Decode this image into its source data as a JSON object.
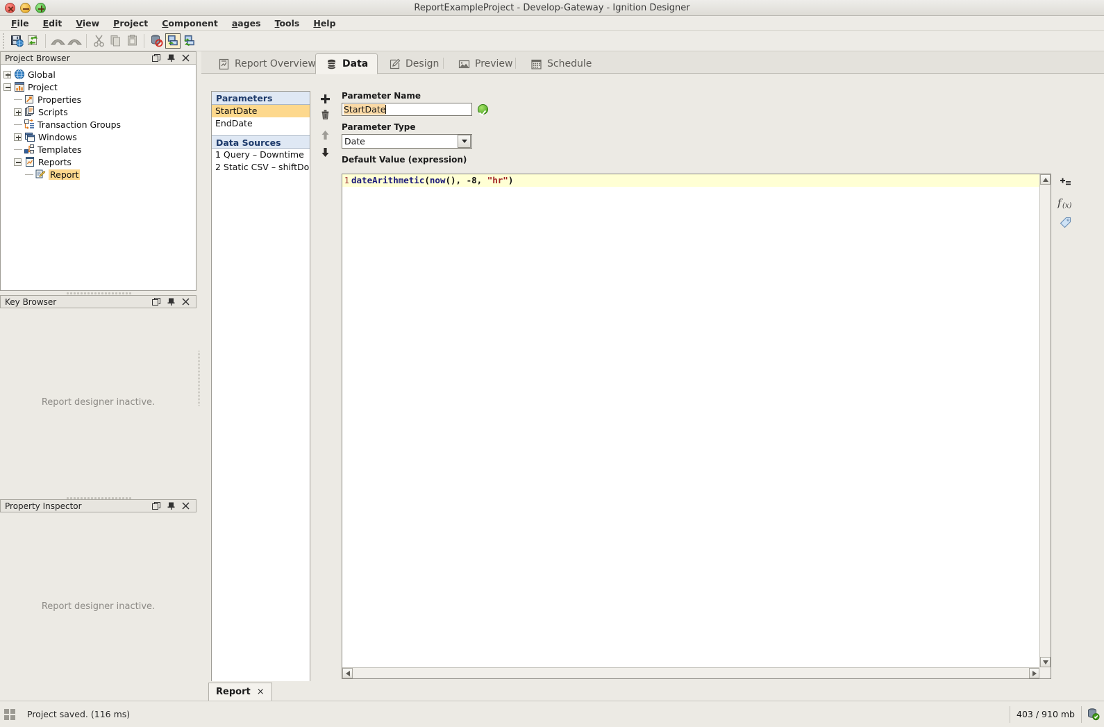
{
  "window": {
    "title": "ReportExampleProject - Develop-Gateway - Ignition Designer",
    "close_icon": "close-icon",
    "minimize_icon": "minimize-icon",
    "maximize_icon": "maximize-icon"
  },
  "menubar": {
    "items": [
      {
        "label": "File",
        "mnemonic": "F"
      },
      {
        "label": "Edit",
        "mnemonic": "E"
      },
      {
        "label": "View",
        "mnemonic": "V"
      },
      {
        "label": "Project",
        "mnemonic": "P"
      },
      {
        "label": "Component",
        "mnemonic": "C"
      },
      {
        "label": "Pages",
        "mnemonic": "P"
      },
      {
        "label": "Tools",
        "mnemonic": "T"
      },
      {
        "label": "Help",
        "mnemonic": "H"
      }
    ]
  },
  "toolbar": {
    "buttons": [
      {
        "name": "save-icon",
        "tip": "Save"
      },
      {
        "name": "publish-icon",
        "tip": "Save and Publish"
      },
      {
        "name": "undo-icon",
        "tip": "Undo"
      },
      {
        "name": "redo-icon",
        "tip": "Redo"
      },
      {
        "name": "cut-icon",
        "tip": "Cut"
      },
      {
        "name": "copy-icon",
        "tip": "Copy"
      },
      {
        "name": "paste-icon",
        "tip": "Paste"
      },
      {
        "name": "database-disabled-icon",
        "tip": "Comm Off"
      },
      {
        "name": "designer-comm-read-icon",
        "tip": "Comm Read Only"
      },
      {
        "name": "designer-comm-readwrite-icon",
        "tip": "Comm Read/Write"
      }
    ]
  },
  "project_browser": {
    "title": "Project Browser",
    "float_icon": "float-icon",
    "pin_icon": "pin-icon",
    "close_icon": "close-icon",
    "tree": [
      {
        "label": "Global",
        "depth": 0,
        "expander": "plus",
        "icon": "globe-icon"
      },
      {
        "label": "Project",
        "depth": 0,
        "expander": "minus",
        "icon": "project-icon"
      },
      {
        "label": "Properties",
        "depth": 1,
        "expander": "none",
        "icon": "properties-icon"
      },
      {
        "label": "Scripts",
        "depth": 1,
        "expander": "plus",
        "icon": "scripts-icon"
      },
      {
        "label": "Transaction Groups",
        "depth": 1,
        "expander": "none",
        "icon": "transaction-groups-icon"
      },
      {
        "label": "Windows",
        "depth": 1,
        "expander": "plus",
        "icon": "windows-icon"
      },
      {
        "label": "Templates",
        "depth": 1,
        "expander": "none",
        "icon": "templates-icon"
      },
      {
        "label": "Reports",
        "depth": 1,
        "expander": "minus",
        "icon": "reports-icon"
      },
      {
        "label": "Report",
        "depth": 2,
        "expander": "none",
        "icon": "report-icon",
        "selected": true
      }
    ]
  },
  "key_browser": {
    "title": "Key Browser",
    "float_icon": "float-icon",
    "pin_icon": "pin-icon",
    "close_icon": "close-icon",
    "empty_message": "Report designer inactive."
  },
  "property_inspector": {
    "title": "Property Inspector",
    "float_icon": "float-icon",
    "pin_icon": "pin-icon",
    "close_icon": "close-icon",
    "empty_message": "Report designer inactive."
  },
  "workspace": {
    "tabs": [
      {
        "label": "Report Overview",
        "icon": "report-overview-icon",
        "active": false
      },
      {
        "label": "Data",
        "icon": "database-icon",
        "active": true
      },
      {
        "label": "Design",
        "icon": "design-pencil-icon",
        "active": false
      },
      {
        "label": "Preview",
        "icon": "preview-image-icon",
        "active": false
      },
      {
        "label": "Schedule",
        "icon": "calendar-icon",
        "active": false
      }
    ]
  },
  "data_panel": {
    "parameters_header": "Parameters",
    "parameters": [
      {
        "label": "StartDate",
        "selected": true
      },
      {
        "label": "EndDate",
        "selected": false
      }
    ],
    "data_sources_header": "Data Sources",
    "data_sources": [
      {
        "label": "1 Query – Downtime"
      },
      {
        "label": "2 Static CSV – shiftDo…"
      }
    ],
    "buttons": [
      {
        "name": "add-button",
        "icon": "plus-icon"
      },
      {
        "name": "delete-button",
        "icon": "trash-icon"
      },
      {
        "name": "move-up-button",
        "icon": "arrow-up-icon"
      },
      {
        "name": "move-down-button",
        "icon": "arrow-down-icon"
      }
    ]
  },
  "form": {
    "parameter_name_label": "Parameter Name",
    "parameter_name_value": "StartDate",
    "validation_icon": "valid-check-icon",
    "parameter_type_label": "Parameter Type",
    "parameter_type_value": "Date",
    "parameter_type_options": [
      "Date"
    ],
    "default_value_label": "Default Value (expression)"
  },
  "expression_editor": {
    "lines": [
      {
        "number": "1",
        "tokens": [
          {
            "text": "dateArithmetic",
            "type": "fn"
          },
          {
            "text": "(",
            "type": "punc"
          },
          {
            "text": "now",
            "type": "fn"
          },
          {
            "text": "(), ",
            "type": "punc"
          },
          {
            "text": "-8",
            "type": "num"
          },
          {
            "text": ", ",
            "type": "punc"
          },
          {
            "text": "\"hr\"",
            "type": "str"
          },
          {
            "text": ")",
            "type": "punc"
          }
        ]
      }
    ],
    "plain_text": "dateArithmetic(now(), -8, \"hr\")",
    "tools": [
      {
        "name": "insert-variable-icon"
      },
      {
        "name": "function-fx-icon"
      },
      {
        "name": "tag-browse-icon"
      }
    ],
    "scroll_up_icon": "scroll-up-icon",
    "scroll_down_icon": "scroll-down-icon",
    "scroll_left_icon": "scroll-left-icon",
    "scroll_right_icon": "scroll-right-icon"
  },
  "document_tabs": [
    {
      "label": "Report",
      "close_glyph": "×",
      "active": true
    }
  ],
  "status_bar": {
    "grid_icon": "status-grid-icon",
    "message": "Project saved. (116 ms)",
    "memory": "403 / 910 mb",
    "gateway_icon": "gateway-connected-icon"
  },
  "colors": {
    "chrome": "#eceae4",
    "selection_orange": "#fdd88d",
    "section_header_bg": "#dfe8f4",
    "section_header_text": "#1d3a6b",
    "current_line": "#ffffd4",
    "string_token": "#a02020",
    "function_token": "#1a1a7a"
  }
}
